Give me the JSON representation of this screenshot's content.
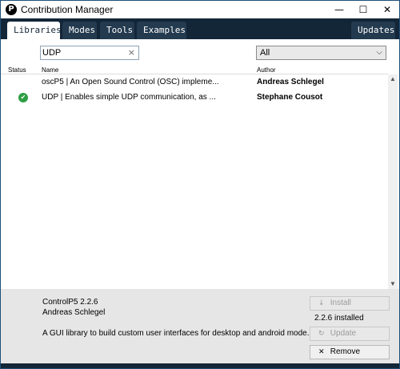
{
  "window": {
    "title": "Contribution Manager",
    "app_icon": "P",
    "controls": {
      "minimize": "—",
      "maximize": "☐",
      "close": "✕"
    }
  },
  "tabs": [
    {
      "label": "Libraries",
      "active": true
    },
    {
      "label": "Modes",
      "active": false
    },
    {
      "label": "Tools",
      "active": false
    },
    {
      "label": "Examples",
      "active": false
    }
  ],
  "updates_tab": {
    "label": "Updates"
  },
  "search": {
    "value": "UDP",
    "clear_icon": "×"
  },
  "filter": {
    "selected": "All",
    "chevron": "⌵"
  },
  "columns": {
    "status": "Status",
    "name": "Name",
    "author": "Author"
  },
  "rows": [
    {
      "status": "",
      "name": "oscP5 | An Open Sound Control (OSC) impleme...",
      "author": "Andreas Schlegel"
    },
    {
      "status": "installed",
      "status_glyph": "✔",
      "name": "UDP | Enables simple UDP communication, as ...",
      "author": "Stephane Cousot"
    }
  ],
  "scrollbar": {
    "up": "▲",
    "down": "▼"
  },
  "details": {
    "name": "ControlP5 2.2.6",
    "author": "Andreas Schlegel",
    "description": "A GUI library to build custom user interfaces for desktop and android mode.",
    "installed_label": "2.2.6 installed",
    "install_button": {
      "icon": "↓",
      "label": "Install"
    },
    "update_button": {
      "icon": "↻",
      "label": "Update"
    },
    "remove_button": {
      "icon": "✕",
      "label": "Remove"
    }
  },
  "colors": {
    "tab_bar": "#132638",
    "status_ok": "#2e9e43",
    "details_bg": "#e6e6e6"
  }
}
